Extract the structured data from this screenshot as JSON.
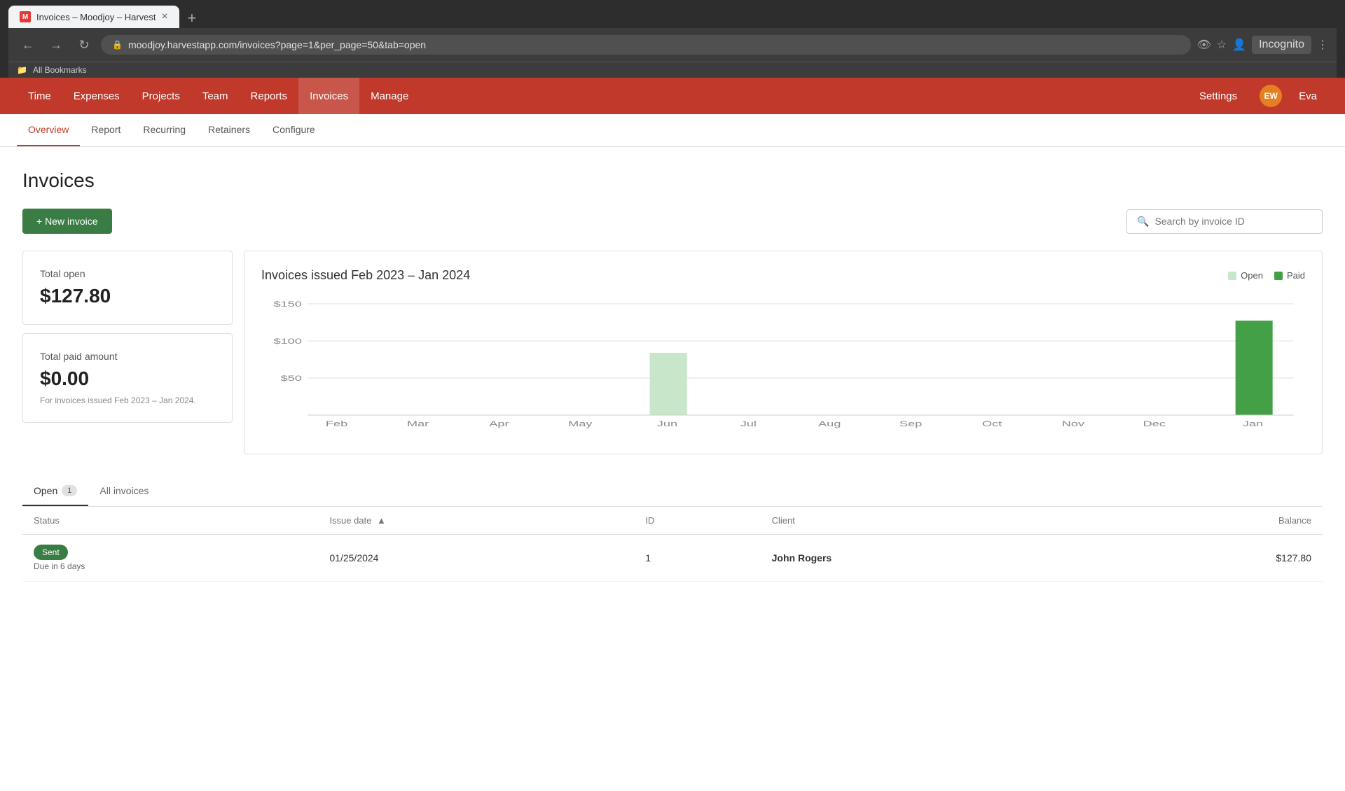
{
  "browser": {
    "tab_title": "Invoices – Moodjoy – Harvest",
    "tab_favicon": "M",
    "url": "moodjoy.harvestapp.com/invoices?page=1&per_page=50&tab=open",
    "incognito_label": "Incognito",
    "bookmarks_label": "All Bookmarks"
  },
  "topnav": {
    "items": [
      {
        "label": "Time",
        "active": false
      },
      {
        "label": "Expenses",
        "active": false
      },
      {
        "label": "Projects",
        "active": false
      },
      {
        "label": "Team",
        "active": false
      },
      {
        "label": "Reports",
        "active": false
      },
      {
        "label": "Invoices",
        "active": true
      },
      {
        "label": "Manage",
        "active": false
      }
    ],
    "settings_label": "Settings",
    "user_initials": "EW",
    "user_name": "Eva"
  },
  "subnav": {
    "items": [
      {
        "label": "Overview",
        "active": true
      },
      {
        "label": "Report",
        "active": false
      },
      {
        "label": "Recurring",
        "active": false
      },
      {
        "label": "Retainers",
        "active": false
      },
      {
        "label": "Configure",
        "active": false
      }
    ]
  },
  "page": {
    "title": "Invoices",
    "new_invoice_label": "+ New invoice",
    "search_placeholder": "Search by invoice ID"
  },
  "stats": {
    "total_open_label": "Total open",
    "total_open_value": "$127.80",
    "total_paid_label": "Total paid amount",
    "total_paid_value": "$0.00",
    "total_paid_note": "For invoices issued Feb 2023 – Jan 2024."
  },
  "chart": {
    "title": "Invoices issued Feb 2023 – Jan 2024",
    "legend_open": "Open",
    "legend_paid": "Paid",
    "colors": {
      "open": "#c8e6c9",
      "paid": "#43a047"
    },
    "y_labels": [
      "$150",
      "$100",
      "$50"
    ],
    "x_labels": [
      "Feb",
      "Mar",
      "Apr",
      "May",
      "Jun",
      "Jul",
      "Aug",
      "Sep",
      "Oct",
      "Nov",
      "Dec",
      "Jan"
    ],
    "bars": [
      {
        "month": "Feb",
        "open": 0,
        "paid": 0
      },
      {
        "month": "Mar",
        "open": 0,
        "paid": 0
      },
      {
        "month": "Apr",
        "open": 0,
        "paid": 0
      },
      {
        "month": "May",
        "open": 0,
        "paid": 0
      },
      {
        "month": "Jun",
        "open": 85,
        "paid": 0
      },
      {
        "month": "Jul",
        "open": 0,
        "paid": 0
      },
      {
        "month": "Aug",
        "open": 0,
        "paid": 0
      },
      {
        "month": "Sep",
        "open": 0,
        "paid": 0
      },
      {
        "month": "Oct",
        "open": 0,
        "paid": 0
      },
      {
        "month": "Nov",
        "open": 0,
        "paid": 0
      },
      {
        "month": "Dec",
        "open": 0,
        "paid": 0
      },
      {
        "month": "Jan",
        "open": 0,
        "paid": 128
      }
    ]
  },
  "invoice_tabs": [
    {
      "label": "Open",
      "count": "1",
      "active": true
    },
    {
      "label": "All invoices",
      "count": "",
      "active": false
    }
  ],
  "table": {
    "columns": [
      {
        "label": "Status"
      },
      {
        "label": "Issue date",
        "sortable": true,
        "sort_dir": "asc"
      },
      {
        "label": "ID"
      },
      {
        "label": "Client"
      },
      {
        "label": "Balance",
        "align": "right"
      }
    ],
    "rows": [
      {
        "status": "Sent",
        "status_class": "status-sent",
        "due_text": "Due in 6 days",
        "issue_date": "01/25/2024",
        "id": "1",
        "client": "John Rogers",
        "balance": "$127.80"
      }
    ]
  }
}
